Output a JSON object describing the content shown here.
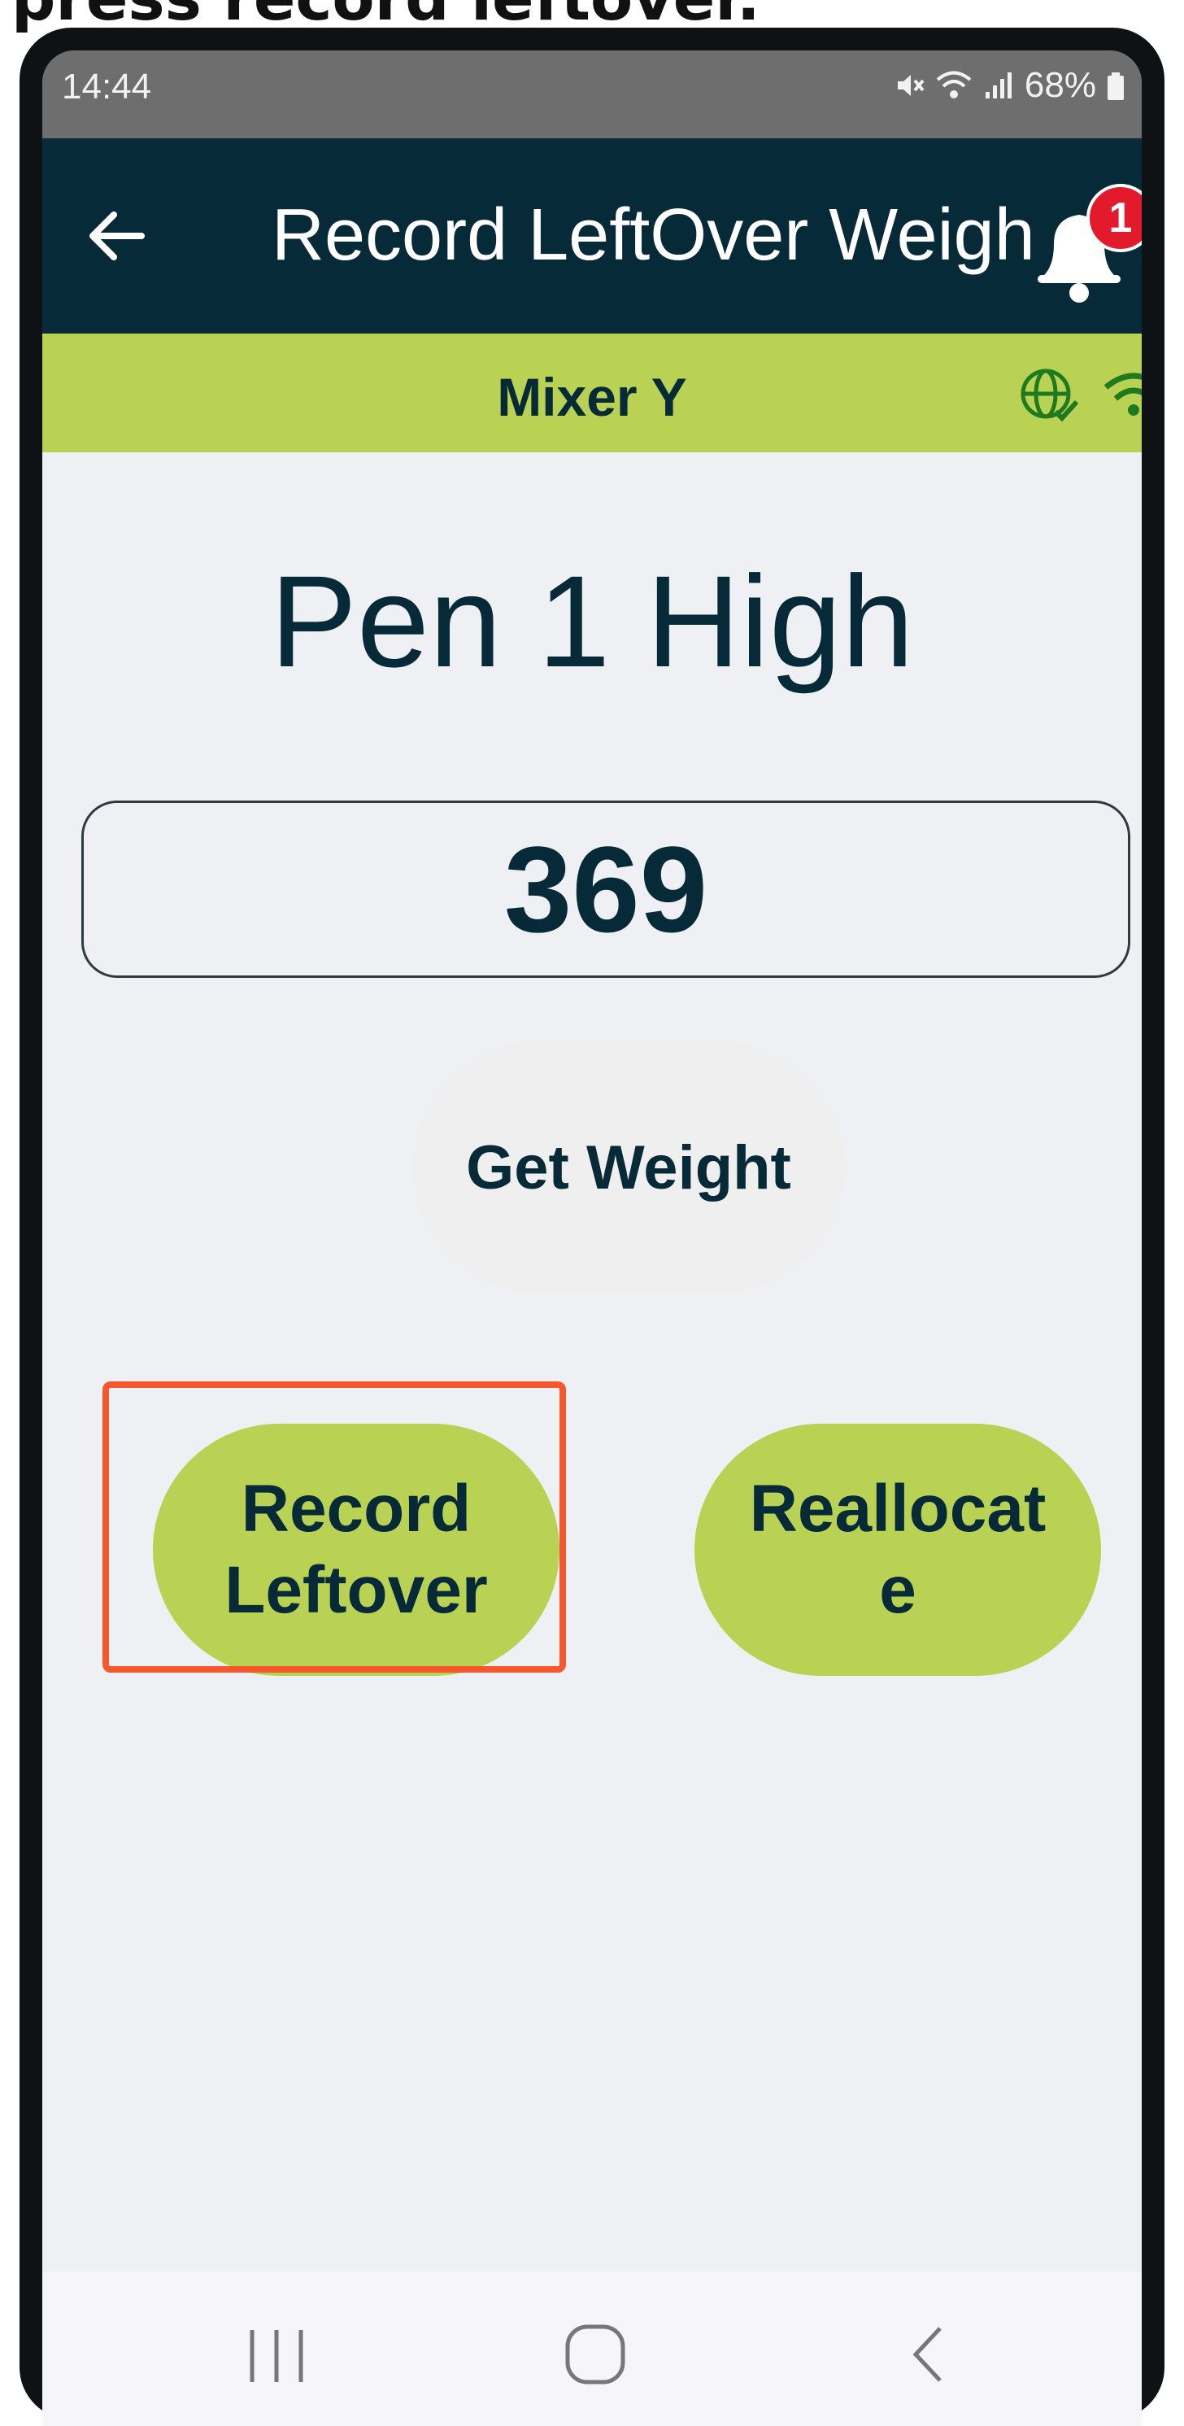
{
  "caption": "press record leftover.",
  "status_bar": {
    "time": "14:44",
    "battery": "68%"
  },
  "app_bar": {
    "title": "Record LeftOver Weigh",
    "notification_count": "1"
  },
  "mixer_bar": {
    "label": "Mixer Y"
  },
  "main": {
    "pen_title": "Pen 1 High",
    "weight_value": "369",
    "get_weight_label": "Get Weight",
    "record_leftover_line1": "Record",
    "record_leftover_line2": "Leftover",
    "reallocate_line1": "Reallocat",
    "reallocate_line2": "e"
  },
  "colors": {
    "app_bar": "#062a37",
    "accent_green": "#bad254",
    "highlight": "#f5582d",
    "badge": "#e21a2c"
  }
}
